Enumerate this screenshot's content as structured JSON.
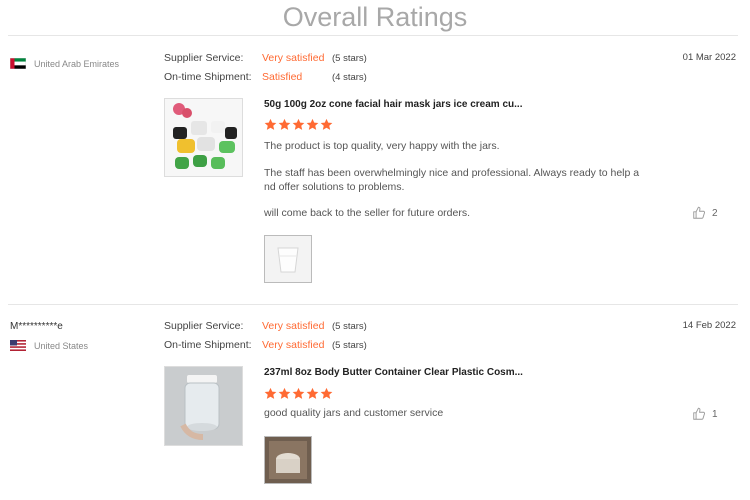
{
  "page": {
    "title": "Overall Ratings"
  },
  "colors": {
    "accent": "#ff6a33",
    "title_gray": "#a8a8a8"
  },
  "reviews": [
    {
      "buyer": "",
      "country": "United Arab Emirates",
      "flag_icon": "uae-flag-icon",
      "supplier_service": {
        "label": "Supplier Service:",
        "value": "Very satisfied",
        "stars": "(5 stars)"
      },
      "shipment": {
        "label": "On-time Shipment:",
        "value": "Satisfied",
        "stars": "(4 stars)"
      },
      "date": "01 Mar 2022",
      "product_title": "50g 100g 2oz cone facial hair mask jars ice cream cu...",
      "rating": 5,
      "paragraphs": [
        "The product is top quality, very happy with the jars.",
        "The staff has been overwhelmingly nice and professional. Always ready to help a nd offer solutions to problems.",
        "will come back to the seller for future orders."
      ],
      "likes": "2"
    },
    {
      "buyer": "M**********e",
      "country": "United States",
      "flag_icon": "us-flag-icon",
      "supplier_service": {
        "label": "Supplier Service:",
        "value": "Very satisfied",
        "stars": "(5 stars)"
      },
      "shipment": {
        "label": "On-time Shipment:",
        "value": "Very satisfied",
        "stars": "(5 stars)"
      },
      "date": "14 Feb 2022",
      "product_title": "237ml 8oz Body Butter Container Clear Plastic Cosm...",
      "rating": 5,
      "paragraphs": [
        "good quality jars and customer service"
      ],
      "likes": "1"
    }
  ]
}
